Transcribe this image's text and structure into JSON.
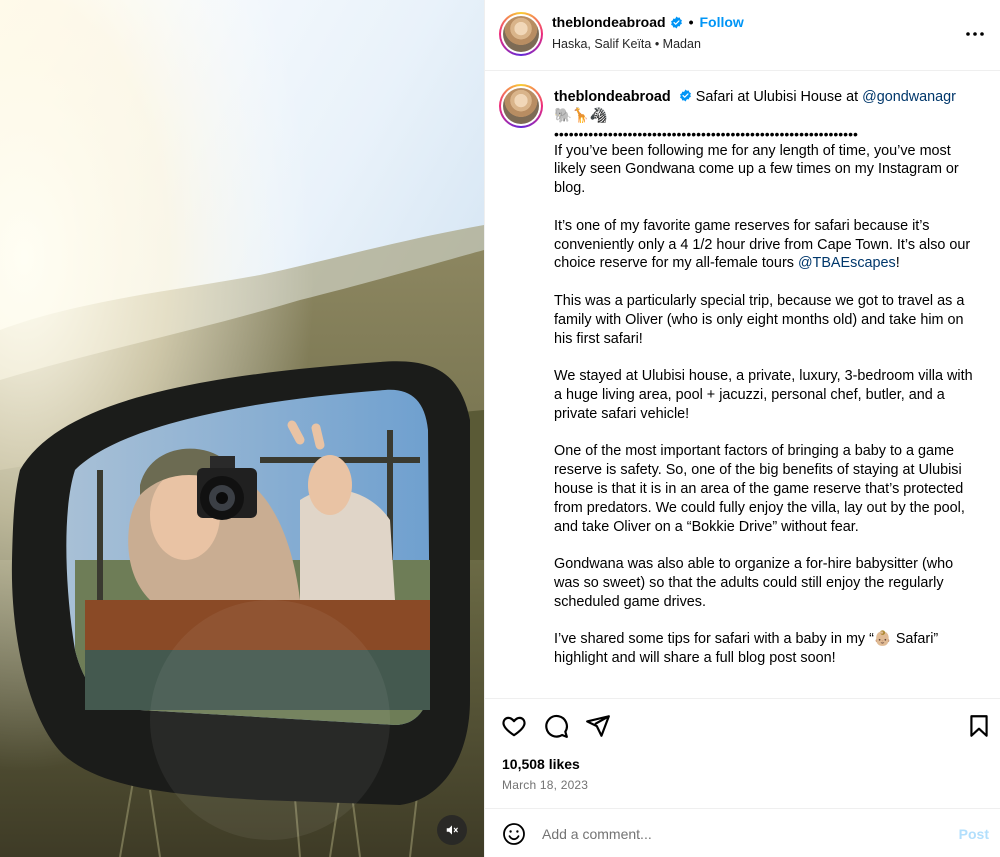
{
  "post": {
    "username": "theblondeabroad",
    "follow_label": "Follow",
    "separator": "•",
    "audio": "Haska, Salif Keïta • Madan",
    "verified": true
  },
  "caption": {
    "username": "theblondeabroad",
    "title_text": "Safari at Ulubisi House at ",
    "title_mention": "@gondwanagr",
    "emoji_line": "🐘🦒🦓",
    "divider": "••••••••••••••••••••••••••••••••••••••••••••••••••••••••••••••",
    "p1": "If you’ve been following me for any length of time, you’ve most likely seen Gondwana come up a few times on my Instagram or blog.",
    "p2_text": "It’s one of my favorite game reserves for safari because it’s conveniently only a 4 1/2 hour drive from Cape Town. It’s also our choice reserve for my all-female tours ",
    "p2_mention": "@TBAEscapes",
    "p2_end": "!",
    "p3": "This was a particularly special trip, because we got to travel as a family with Oliver (who is only eight months old) and take him on his first safari!",
    "p4": "We stayed at Ulubisi house, a private, luxury, 3-bedroom villa with a huge living area, pool + jacuzzi, personal chef, butler, and a private safari vehicle!",
    "p5": "One of the most important factors of bringing a baby to a game reserve is safety. So, one of the big benefits of staying at Ulubisi house is that it is in an area of the game reserve that’s protected from predators. We could fully enjoy the villa, lay out by the pool, and take Oliver on a “Bokkie Drive” without fear.",
    "p6": "Gondwana was also able to organize a for-hire babysitter (who was so sweet) so that the adults could still enjoy the regularly scheduled game drives.",
    "p7": "I’ve shared some tips for safari with a baby in my “👶🏼 Safari” highlight and will share a full blog post soon!"
  },
  "stats": {
    "likes": "10,508 likes",
    "date": "March 18, 2023"
  },
  "comment": {
    "placeholder": "Add a comment...",
    "post_label": "Post"
  },
  "icons": {
    "more": "more-options-icon",
    "like": "heart-icon",
    "comment": "comment-icon",
    "share": "share-icon",
    "save": "bookmark-icon",
    "emoji": "emoji-icon",
    "mute": "speaker-muted-icon",
    "verified": "verified-badge-icon"
  },
  "colors": {
    "link": "#00376b",
    "follow": "#0095f6",
    "post_disabled": "#b2dffc",
    "verified": "#0095f6"
  }
}
